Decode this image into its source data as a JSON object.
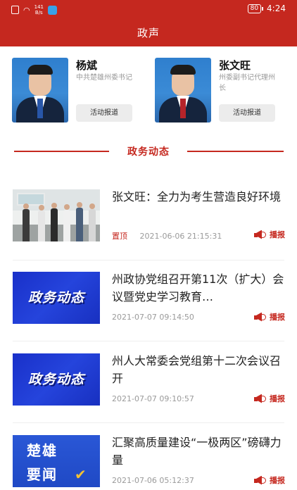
{
  "status_bar": {
    "net_speed": "141\nB/s",
    "battery": "80",
    "time": "4:24"
  },
  "header": {
    "title": "政声"
  },
  "leaders": [
    {
      "name": "杨斌",
      "role": "中共楚雄州委书记",
      "button": "活动报道"
    },
    {
      "name": "张文旺",
      "role": "州委副书记代理州长",
      "button": "活动报道"
    }
  ],
  "section": {
    "title": "政务动态"
  },
  "news": [
    {
      "title": "张文旺：全力为考生营造良好环境",
      "pinned": "置顶",
      "time": "2021-06-06 21:15:31",
      "play_label": "播报",
      "thumb": "meeting-photo"
    },
    {
      "title": "州政协党组召开第11次（扩大）会议暨党史学习教育…",
      "pinned": "",
      "time": "2021-07-07 09:14:50",
      "play_label": "播报",
      "thumb_text": "政务动态"
    },
    {
      "title": "州人大常委会党组第十二次会议召开",
      "pinned": "",
      "time": "2021-07-07 09:10:57",
      "play_label": "播报",
      "thumb_text": "政务动态"
    },
    {
      "title": "汇聚高质量建设“一极两区”磅礴力量",
      "pinned": "",
      "time": "2021-07-06 05:12:37",
      "play_label": "播报",
      "thumb_lines": [
        "楚雄",
        "要闻"
      ]
    }
  ],
  "colors": {
    "brand_red": "#c5281f",
    "banner_blue": "#2544dc"
  }
}
